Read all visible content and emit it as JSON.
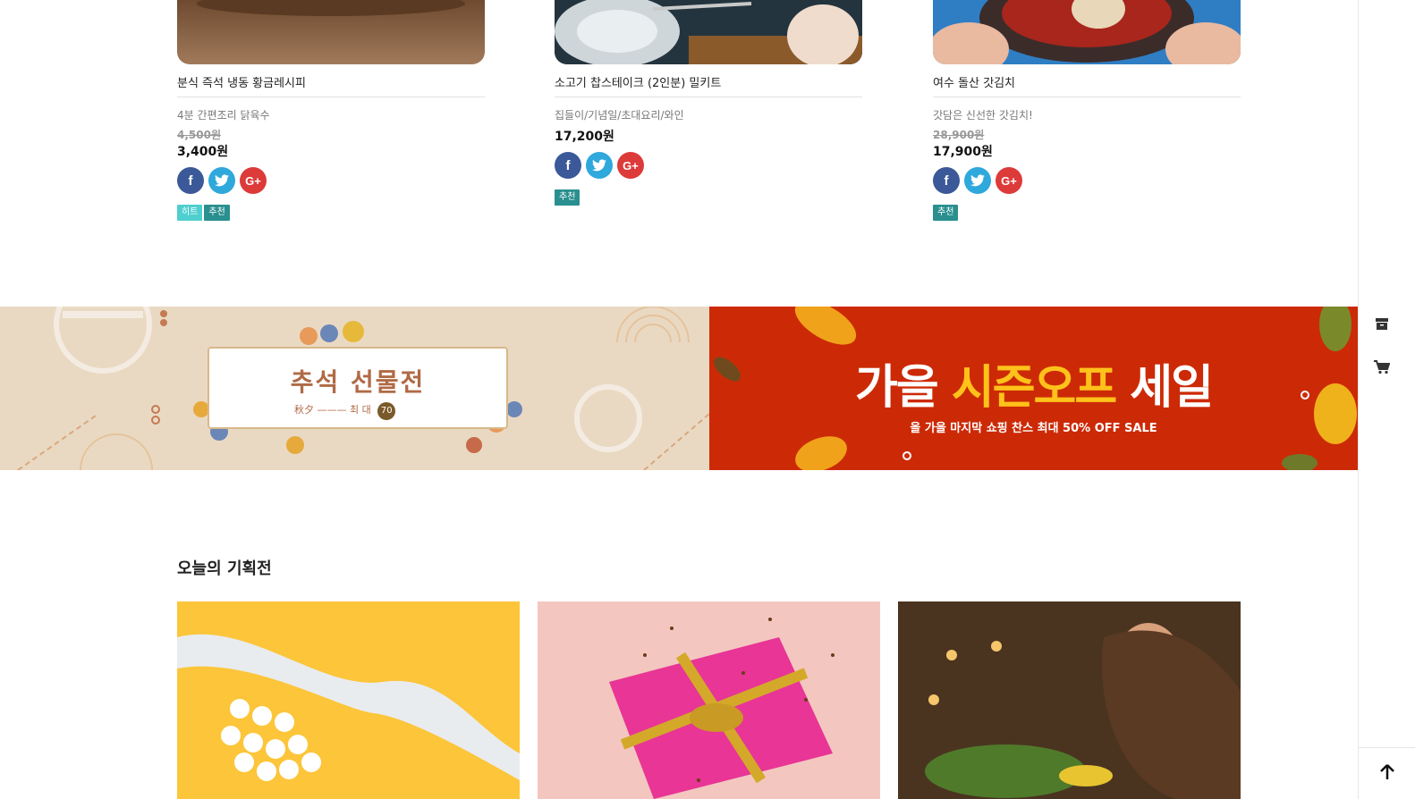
{
  "products": [
    {
      "name": "분식 즉석 냉동 황금레시피",
      "desc": "4분 간편조리 닭육수",
      "orig_price": "4,500원",
      "price": "3,400원",
      "badges": [
        "히트",
        "추천"
      ]
    },
    {
      "name": "소고기 찹스테이크 (2인분) 밀키트",
      "desc": "집들이/기념일/초대요리/와인",
      "orig_price": "",
      "price": "17,200원",
      "badges": [
        "추천"
      ]
    },
    {
      "name": "여수 돌산 갓김치",
      "desc": "갓담은 신선한 갓김치!",
      "orig_price": "28,900원",
      "price": "17,900원",
      "badges": [
        "추천"
      ]
    }
  ],
  "social": {
    "facebook": "f",
    "twitter": "t",
    "google": "G+"
  },
  "banners": {
    "left": {
      "title": "추석 선물전",
      "subtitle": "秋夕 ——— 최 대",
      "badge": "70"
    },
    "right": {
      "title_a": "가을 ",
      "title_b": "시즌오프",
      "title_c": " 세일",
      "subtitle": "올 가을 마지막 쇼핑 찬스 최대 50% OFF SALE"
    }
  },
  "section": {
    "title": "오늘의 기획전"
  },
  "sidebar": {
    "icons": [
      "archive-icon",
      "cart-icon"
    ],
    "top": "arrow-up-icon"
  },
  "colors": {
    "hit": "#4fcfcf",
    "rec": "#2a8f8f",
    "banner_red": "#cc2a06",
    "banner_beige": "#ead9c2"
  }
}
